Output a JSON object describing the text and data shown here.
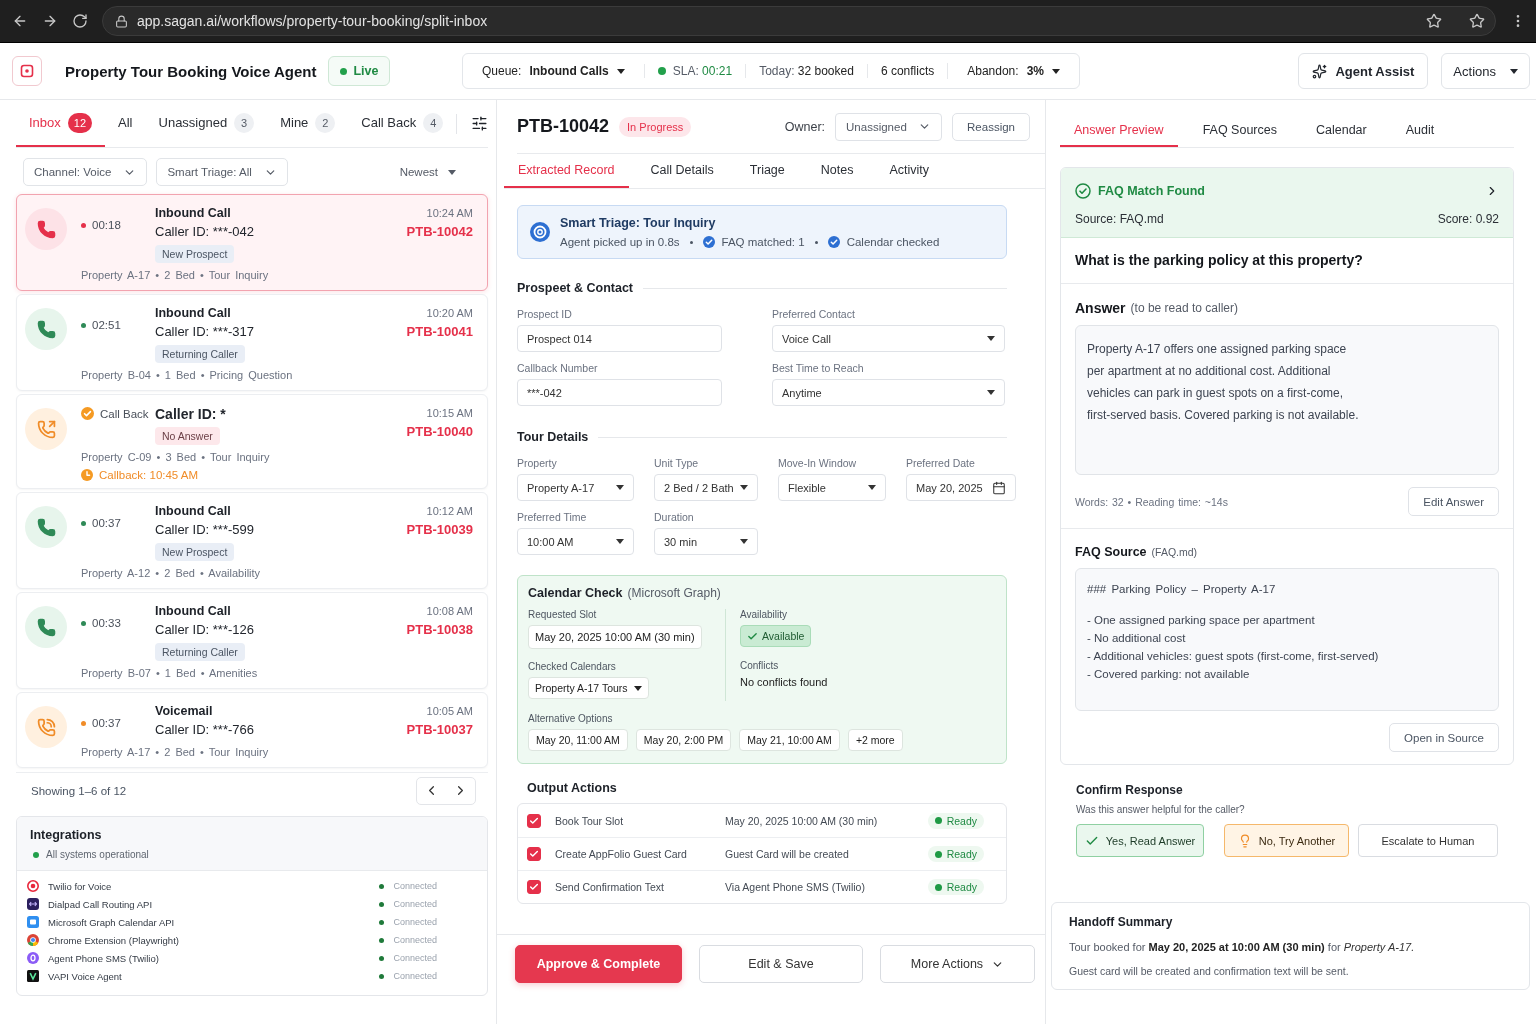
{
  "browser": {
    "url": "app.sagan.ai/workflows/property-tour-booking/split-inbox"
  },
  "header": {
    "title": "Property Tour Booking Voice Agent",
    "status": "Live",
    "stats": [
      {
        "kind": "select",
        "label": "Queue:",
        "value": "Inbound Calls"
      },
      {
        "kind": "sla",
        "label": "SLA:",
        "value": "00:21"
      },
      {
        "kind": "metric",
        "label": "Today:",
        "value": "32 booked"
      },
      {
        "kind": "metric",
        "value": "6 conflicts"
      },
      {
        "kind": "select",
        "label": "Abandon:",
        "value": "3%"
      }
    ],
    "assist_button": "Agent Assist",
    "actions_button": "Actions"
  },
  "inbox": {
    "tabs": [
      {
        "label": "Inbox",
        "count": "12",
        "selected": true
      },
      {
        "label": "All",
        "selected": false
      },
      {
        "label": "Unassigned",
        "count": "3",
        "selected": false
      },
      {
        "label": "Mine",
        "count": "2",
        "selected": false
      },
      {
        "label": "Call Back",
        "count": "4",
        "selected": false
      }
    ],
    "filters": [
      {
        "label": "Channel:",
        "value": "Voice"
      },
      {
        "label": "Smart Triage:",
        "value": "All"
      }
    ],
    "sort": "Newest",
    "calls": [
      {
        "kind": "inbound",
        "selected": true,
        "duration": "00:18",
        "title": "Inbound Call",
        "caller": "Caller ID: ***-042",
        "tag": {
          "label": "New Prospect",
          "alert": false
        },
        "details": "Property A-17 • 2 Bed • Tour Inquiry",
        "time": "10:24 AM",
        "id": "PTB-10042"
      },
      {
        "kind": "inbound",
        "selected": false,
        "duration": "02:51",
        "title": "Inbound Call",
        "caller": "Caller ID: ***-317",
        "tag": {
          "label": "Returning Caller",
          "alert": false
        },
        "details": "Property B-04 • 1 Bed • Pricing Question",
        "time": "10:20 AM",
        "id": "PTB-10041"
      },
      {
        "kind": "callback",
        "selected": false,
        "status": "Call Back",
        "caller": "Caller ID: *",
        "tag": {
          "label": "No Answer",
          "alert": true
        },
        "details": "Property C-09 • 3 Bed • Tour Inquiry",
        "callback": "Callback: 10:45 AM",
        "time": "10:15 AM",
        "id": "PTB-10040"
      },
      {
        "kind": "inbound",
        "selected": false,
        "duration": "00:37",
        "title": "Inbound Call",
        "caller": "Caller ID: ***-599",
        "tag": {
          "label": "New Prospect",
          "alert": false
        },
        "details": "Property A-12 • 2 Bed • Availability",
        "time": "10:12 AM",
        "id": "PTB-10039"
      },
      {
        "kind": "inbound",
        "selected": false,
        "duration": "00:33",
        "title": "Inbound Call",
        "caller": "Caller ID: ***-126",
        "tag": {
          "label": "Returning Caller",
          "alert": false
        },
        "details": "Property B-07 • 1 Bed • Amenities",
        "time": "10:08 AM",
        "id": "PTB-10038"
      },
      {
        "kind": "voicemail",
        "selected": false,
        "duration": "00:37",
        "title": "Voicemail",
        "caller": "Caller ID: ***-766",
        "details": "Property A-17 • 2 Bed • Tour Inquiry",
        "time": "10:05 AM",
        "id": "PTB-10037"
      }
    ],
    "pagination": "Showing 1–6 of 12"
  },
  "integrations": {
    "title": "Integrations",
    "status": "All systems operational",
    "items": [
      {
        "name": "Twilio for Voice",
        "status": "Connected",
        "connected": true,
        "color": "#e8283c"
      },
      {
        "name": "Dialpad Call Routing API",
        "status": "Connected",
        "connected": true,
        "color": "#2b1f5e"
      },
      {
        "name": "Microsoft Graph Calendar API",
        "status": "Connected",
        "connected": true,
        "color": "#2f8ff0"
      },
      {
        "name": "Chrome Extension (Playwright)",
        "status": "Connected",
        "connected": true,
        "color": "#db4437"
      },
      {
        "name": "Agent Phone SMS (Twilio)",
        "status": "Connected",
        "connected": true,
        "color": "#8b5cf6"
      },
      {
        "name": "VAPI Voice Agent",
        "status": "Connected",
        "connected": true,
        "color": "#111111"
      }
    ]
  },
  "record": {
    "id": "PTB-10042",
    "status": "In Progress",
    "owner": {
      "label": "Owner:",
      "value": "Unassigned"
    },
    "reassign": "Reassign",
    "tabs": [
      {
        "label": "Extracted Record",
        "selected": true
      },
      {
        "label": "Call Details",
        "selected": false
      },
      {
        "label": "Triage",
        "selected": false
      },
      {
        "label": "Notes",
        "selected": false
      },
      {
        "label": "Activity",
        "selected": false
      }
    ],
    "triage": {
      "title": "Smart Triage: Tour Inquiry",
      "facts": [
        {
          "text": "Agent picked up in 0.8s",
          "checked": false
        },
        {
          "text": "FAQ matched: 1",
          "checked": true
        },
        {
          "text": "Calendar checked",
          "checked": true
        }
      ]
    },
    "sections": [
      {
        "kind": "contact",
        "title": "Prospeet & Contact",
        "fields": [
          {
            "kind": "input",
            "label": "Prospect ID",
            "value": "Prospect 014"
          },
          {
            "kind": "select",
            "label": "Preferred Contact",
            "value": "Voice Call"
          },
          {
            "kind": "input",
            "label": "Callback Number",
            "value": "***-042"
          },
          {
            "kind": "select",
            "label": "Best Time to Reach",
            "value": "Anytime"
          }
        ]
      },
      {
        "kind": "tour",
        "title": "Tour Details",
        "fields": [
          {
            "kind": "select",
            "label": "Property",
            "value": "Property A-17"
          },
          {
            "kind": "select",
            "label": "Unit Type",
            "value": "2 Bed / 2 Bath"
          },
          {
            "kind": "select",
            "label": "Move-In Window",
            "value": "Flexible"
          },
          {
            "kind": "date",
            "label": "Preferred Date",
            "value": "May 20, 2025"
          },
          {
            "kind": "select",
            "label": "Preferred Time",
            "value": "10:00 AM"
          },
          {
            "kind": "select",
            "label": "Duration",
            "value": "30 min"
          }
        ]
      }
    ],
    "calendar_check": {
      "title": "Calendar Check",
      "source": "(Microsoft Graph)",
      "requested_label": "Requested Slot",
      "requested": "May 20, 2025 10:00 AM (30 min)",
      "calendars_label": "Checked Calendars",
      "calendar": "Property A-17 Tours",
      "availability_label": "Availability",
      "availability": "Available",
      "available": true,
      "conflicts_label": "Conflicts",
      "conflicts": "No conflicts found",
      "alternatives_label": "Alternative Options",
      "alternatives": [
        "May 20, 11:00 AM",
        "May 20, 2:00 PM",
        "May 21, 10:00 AM"
      ],
      "more": "+2 more"
    },
    "output_actions": {
      "title": "Output Actions",
      "items": [
        {
          "label": "Book Tour Slot",
          "detail": "May 20, 2025 10:00 AM (30 min)",
          "status": "Ready",
          "checked": true
        },
        {
          "label": "Create AppFolio Guest Card",
          "detail": "Guest Card will be created",
          "status": "Ready",
          "checked": true
        },
        {
          "label": "Send Confirmation Text",
          "detail": "Via Agent Phone SMS (Twilio)",
          "status": "Ready",
          "checked": true
        }
      ]
    },
    "buttons": [
      {
        "kind": "primary",
        "label": "Approve & Complete"
      },
      {
        "kind": "secondary",
        "label": "Edit & Save"
      },
      {
        "kind": "menu",
        "label": "More Actions"
      }
    ]
  },
  "assist": {
    "tabs": [
      {
        "label": "Answer Preview",
        "selected": true
      },
      {
        "label": "FAQ Sources",
        "selected": false
      },
      {
        "label": "Calendar",
        "selected": false
      },
      {
        "label": "Audit",
        "selected": false
      }
    ],
    "match": {
      "title": "FAQ Match Found",
      "source": "Source: FAQ.md",
      "score": "Score: 0.92"
    },
    "question": "What is the parking policy at this property?",
    "answer": {
      "title": "Answer",
      "note": "(to be read to caller)",
      "text": "Property A-17 offers one assigned parking space\nper apartment at no additional cost. Additional\nvehicles can park in guest spots on a first-come,\nfirst-served basis. Covered parking is not available.",
      "meta": "Words: 32 • Reading time: ~14s",
      "edit": "Edit Answer"
    },
    "source": {
      "title": "FAQ Source",
      "file": "(FAQ.md)",
      "heading": "### Parking Policy – Property A-17",
      "lines": [
        "- One assigned parking space per apartment",
        "- No additional cost",
        "- Additional vehicles: guest spots (first-come, first-served)",
        "- Covered parking: not available"
      ],
      "button": "Open in Source"
    },
    "confirm": {
      "title": "Confirm Response",
      "question": "Was this answer helpful for the caller?",
      "buttons": [
        {
          "kind": "positive",
          "label": "Yes, Read Answer"
        },
        {
          "kind": "negative",
          "label": "No, Try Another"
        },
        {
          "kind": "escalate",
          "label": "Escalate to Human"
        }
      ]
    },
    "handoff": {
      "title": "Handoff Summary",
      "lines": [
        "Tour booked for **May 20, 2025 at 10:00 AM (30 min)** for *Property A-17.*",
        "Guest card will be created and confirmation text will be sent."
      ]
    }
  }
}
